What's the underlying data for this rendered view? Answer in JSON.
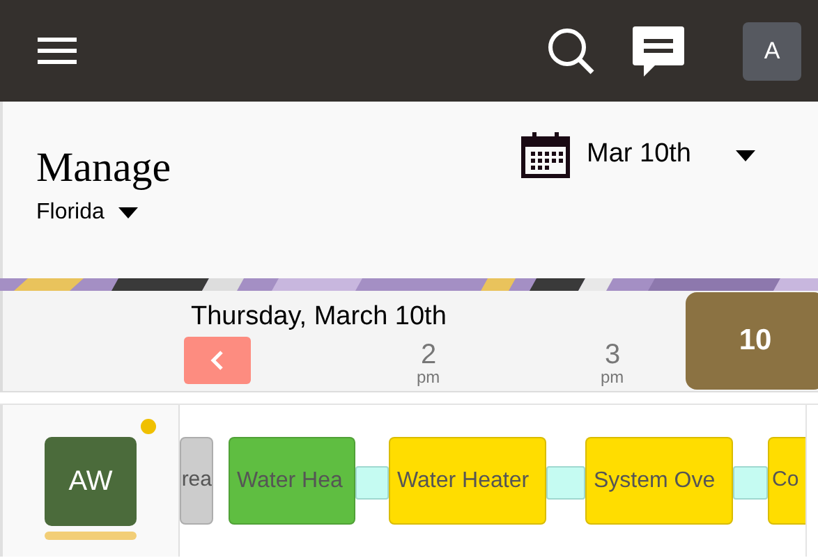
{
  "header": {
    "avatar_initial": "A"
  },
  "page": {
    "title": "Manage",
    "region": "Florida",
    "date": "Mar 10th"
  },
  "timeline": {
    "day_label": "Thursday, March 10th",
    "day_badge": "10",
    "hours": [
      {
        "hour": "2",
        "suffix": "pm"
      },
      {
        "hour": "3",
        "suffix": "pm"
      }
    ]
  },
  "technician": {
    "initials": "AW",
    "notification": true
  },
  "jobs": [
    {
      "label": "rea",
      "color": "#cccccc"
    },
    {
      "label": "Water Hea",
      "color": "#5fbe41"
    },
    {
      "label": "Water Heater",
      "color": "#ffdd00"
    },
    {
      "label": "System Ove",
      "color": "#ffdd00"
    },
    {
      "label": "Co",
      "color": "#ffdd00"
    }
  ]
}
